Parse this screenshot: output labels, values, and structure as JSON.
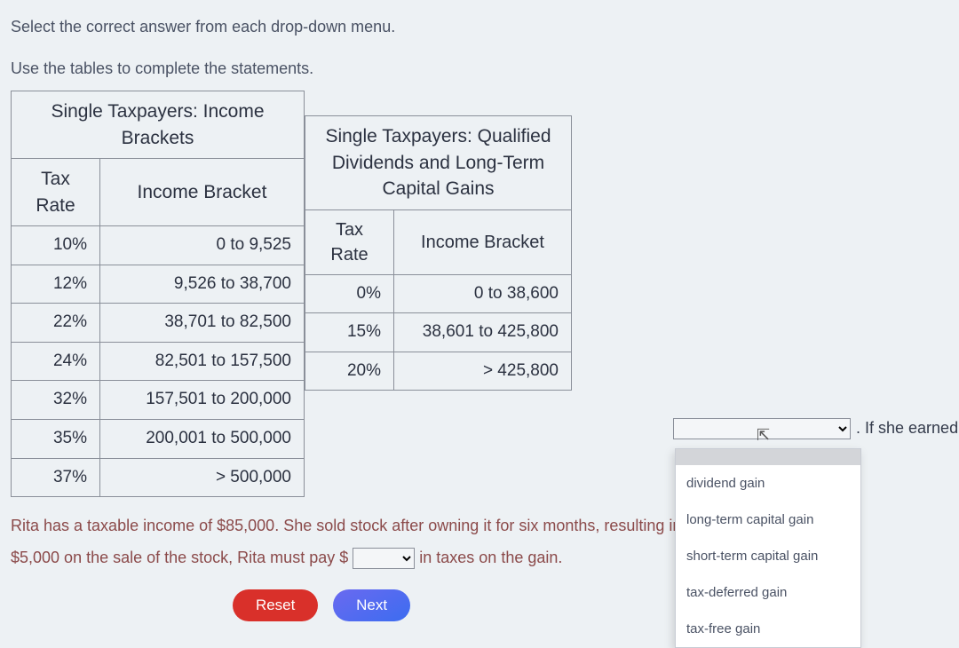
{
  "instruction": "Select the correct answer from each drop-down menu.",
  "subtitle": "Use the tables to complete the statements.",
  "table1": {
    "caption": "Single Taxpayers: Income Brackets",
    "headers": [
      "Tax Rate",
      "Income Bracket"
    ],
    "rows": [
      [
        "10%",
        "0 to 9,525"
      ],
      [
        "12%",
        "9,526 to 38,700"
      ],
      [
        "22%",
        "38,701 to 82,500"
      ],
      [
        "24%",
        "82,501 to 157,500"
      ],
      [
        "32%",
        "157,501 to 200,000"
      ],
      [
        "35%",
        "200,001 to 500,000"
      ],
      [
        "37%",
        "> 500,000"
      ]
    ]
  },
  "table2": {
    "caption": "Single Taxpayers: Qualified Dividends and Long-Term Capital Gains",
    "headers": [
      "Tax Rate",
      "Income Bracket"
    ],
    "rows": [
      [
        "0%",
        "0 to 38,600"
      ],
      [
        "15%",
        "38,601 to 425,800"
      ],
      [
        "20%",
        "> 425,800"
      ]
    ]
  },
  "statement": {
    "part1": "Rita has a taxable income of $85,000. She sold stock after owning it for six months, resulting in a ",
    "after_dd1": ". If she earned",
    "part2_prefix": "$5,000 on the sale of the stock, Rita must pay $",
    "part2_suffix": " in taxes on the gain."
  },
  "dropdown1": {
    "selected": "",
    "options": [
      "dividend gain",
      "long-term capital gain",
      "short-term capital gain",
      "tax-deferred gain",
      "tax-free gain"
    ]
  },
  "dropdown2": {
    "selected": ""
  },
  "buttons": {
    "reset": "Reset",
    "next": "Next"
  }
}
